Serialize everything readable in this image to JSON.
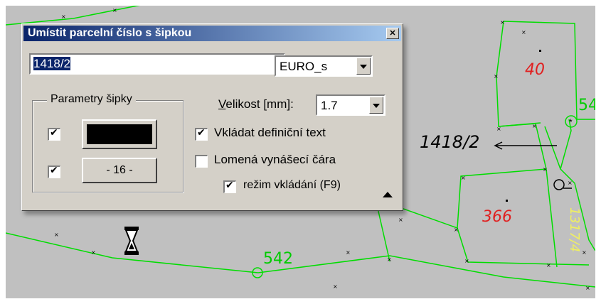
{
  "dialog": {
    "title": "Umístit parcelní číslo s šipkou",
    "parcel_value": "1418/2",
    "font_select": "EURO_s",
    "group_label": "Parametry šipky",
    "size_label_u": "V",
    "size_label_rest": "elikost [mm]:",
    "size_value": "1.7",
    "number_button": "- 16 -",
    "opt_definition_text": "Vkládat definiční text",
    "opt_broken_line": "Lomená vynášecí čára",
    "opt_insert_mode": "režim vkládání (F9)",
    "checkbox_states": {
      "arrow_color": true,
      "arrow_number": true,
      "definition_text": true,
      "broken_line": false,
      "insert_mode": true
    }
  },
  "map": {
    "labels": {
      "parcel_40": "40",
      "parcel_366": "366",
      "parcel_542": "542",
      "parcel_1418_2": "1418/2",
      "parcel_1317_4": "1317/4",
      "parcel_54": "54"
    },
    "colors": {
      "line": "#00dd00",
      "red_label": "#e02020",
      "green_label": "#00cc00",
      "yellow_label": "#f0f060",
      "background": "#c0c0c0"
    }
  },
  "icons": {
    "close": "close-icon",
    "busy_cursor": "hourglass-icon",
    "collapse": "collapse-up-icon"
  }
}
